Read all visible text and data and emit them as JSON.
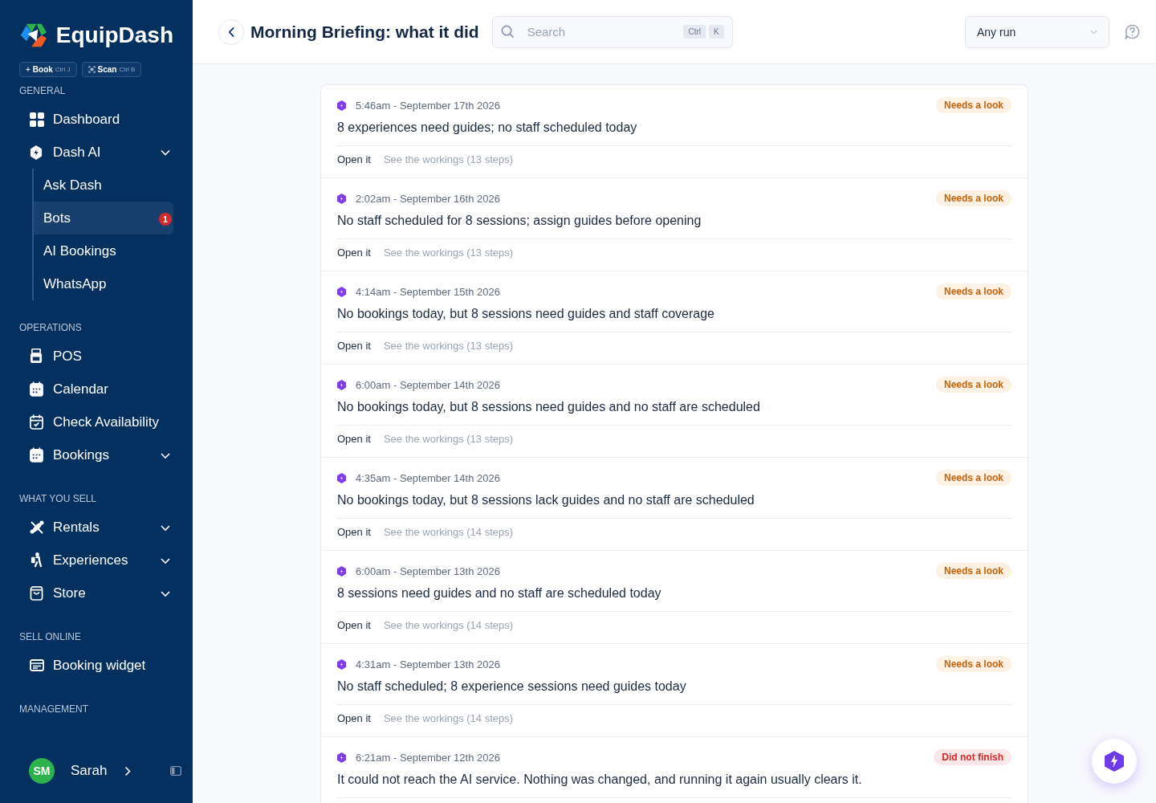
{
  "brand": {
    "name": "EquipDash"
  },
  "quick_actions": [
    {
      "label": "Book",
      "prefix": "+",
      "shortcut": "Ctrl J"
    },
    {
      "label": "Scan",
      "shortcut": "Ctrl B"
    }
  ],
  "sidebar": {
    "sections": [
      {
        "title": "GENERAL",
        "items": [
          {
            "label": "Dashboard"
          },
          {
            "label": "Dash AI",
            "expanded": true,
            "children": [
              {
                "label": "Ask Dash",
                "selected": false
              },
              {
                "label": "Bots",
                "selected": true,
                "badge": "1"
              },
              {
                "label": "AI Bookings",
                "selected": false
              },
              {
                "label": "WhatsApp",
                "selected": false
              }
            ]
          }
        ]
      },
      {
        "title": "OPERATIONS",
        "items": [
          {
            "label": "POS"
          },
          {
            "label": "Calendar"
          },
          {
            "label": "Check Availability"
          },
          {
            "label": "Bookings",
            "expanded": false
          }
        ]
      },
      {
        "title": "WHAT YOU SELL",
        "items": [
          {
            "label": "Rentals",
            "expanded": false
          },
          {
            "label": "Experiences",
            "expanded": false
          },
          {
            "label": "Store",
            "expanded": false
          }
        ]
      },
      {
        "title": "SELL ONLINE",
        "items": [
          {
            "label": "Booking widget"
          }
        ]
      },
      {
        "title": "MANAGEMENT"
      }
    ]
  },
  "user": {
    "initials": "SM",
    "name": "Sarah"
  },
  "header": {
    "title": "Morning Briefing: what it did",
    "search": {
      "placeholder": "Search",
      "keys": [
        "Ctrl",
        "K"
      ]
    },
    "filter": {
      "value": "Any run"
    }
  },
  "runs": [
    {
      "time": "5:46am - September 17th 2026",
      "kind": "warning",
      "status_label": "Needs a look",
      "summary": "8 experiences need guides; no staff scheduled today",
      "open": "Open it",
      "workings": "See the workings (13 steps)"
    },
    {
      "time": "2:02am - September 16th 2026",
      "kind": "warning",
      "status_label": "Needs a look",
      "summary": "No staff scheduled for 8 sessions; assign guides before opening",
      "open": "Open it",
      "workings": "See the workings (13 steps)"
    },
    {
      "time": "4:14am - September 15th 2026",
      "kind": "warning",
      "status_label": "Needs a look",
      "summary": "No bookings today, but 8 sessions need guides and staff coverage",
      "open": "Open it",
      "workings": "See the workings (13 steps)"
    },
    {
      "time": "6:00am - September 14th 2026",
      "kind": "warning",
      "status_label": "Needs a look",
      "summary": "No bookings today, but 8 sessions need guides and no staff are scheduled",
      "open": "Open it",
      "workings": "See the workings (13 steps)"
    },
    {
      "time": "4:35am - September 14th 2026",
      "kind": "warning",
      "status_label": "Needs a look",
      "summary": "No bookings today, but 8 sessions lack guides and no staff are scheduled",
      "open": "Open it",
      "workings": "See the workings (14 steps)"
    },
    {
      "time": "6:00am - September 13th 2026",
      "kind": "warning",
      "status_label": "Needs a look",
      "summary": "8 sessions need guides and no staff are scheduled today",
      "open": "Open it",
      "workings": "See the workings (14 steps)"
    },
    {
      "time": "4:31am - September 13th 2026",
      "kind": "warning",
      "status_label": "Needs a look",
      "summary": "No staff scheduled; 8 experience sessions need guides today",
      "open": "Open it",
      "workings": "See the workings (14 steps)"
    },
    {
      "time": "6:21am - September 12th 2026",
      "kind": "error",
      "status_label": "Did not finish",
      "summary": "It could not reach the AI service. Nothing was changed, and running it again usually clears it."
    }
  ]
}
